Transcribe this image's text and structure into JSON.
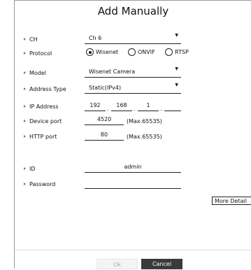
{
  "dialog": {
    "title": "Add Manually"
  },
  "fields": {
    "ch": {
      "label": "CH",
      "value": "Ch 6"
    },
    "protocol": {
      "label": "Protocol",
      "options": [
        "Wisenet",
        "ONVIF",
        "RTSP"
      ],
      "selected": "Wisenet"
    },
    "model": {
      "label": "Model",
      "value": "Wisenet Camera"
    },
    "address_type": {
      "label": "Address Type",
      "value": "Static(IPv4)"
    },
    "ip_address": {
      "label": "IP Address",
      "octets": [
        "192",
        "168",
        "1",
        ""
      ]
    },
    "device_port": {
      "label": "Device port",
      "value": "4520",
      "hint": "(Max.65535)"
    },
    "http_port": {
      "label": "HTTP port",
      "value": "80",
      "hint": "(Max.65535)"
    },
    "id": {
      "label": "ID",
      "value": "admin"
    },
    "password": {
      "label": "Password",
      "value": ""
    }
  },
  "buttons": {
    "more_detail": "More Detail",
    "ok": "Ok",
    "cancel": "Cancel"
  },
  "icons": {
    "row_marker": "triangle-right-icon",
    "dropdown": "caret-down-icon"
  }
}
